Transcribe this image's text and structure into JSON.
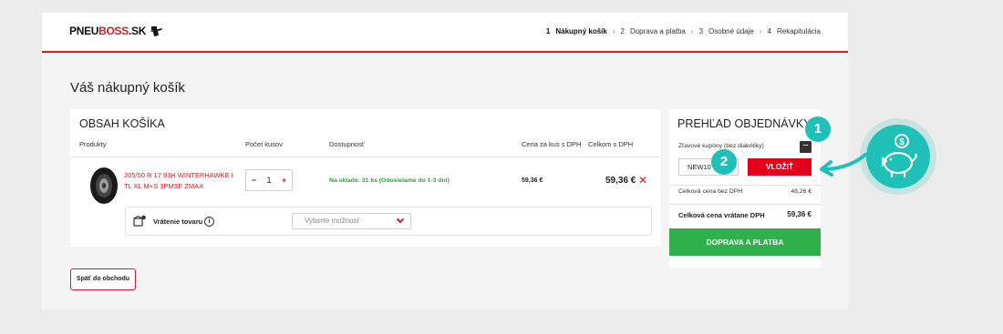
{
  "header": {
    "logo": {
      "pneu": "PNEU",
      "boss": "BOSS",
      "sk": ".SK"
    },
    "steps": [
      {
        "num": "1",
        "label": "Nákupný košík"
      },
      {
        "num": "2",
        "label": "Doprava a platba"
      },
      {
        "num": "3",
        "label": "Osobné údaje"
      },
      {
        "num": "4",
        "label": "Rekapitulácia"
      }
    ]
  },
  "page_title": "Váš nákupný košík",
  "cart": {
    "title": "OBSAH KOŠÍKA",
    "columns": {
      "product": "Produkty",
      "quantity": "Počet kusov",
      "availability": "Dostupnosť",
      "unit_price": "Cena za kus s DPH",
      "total": "Celkom s DPH"
    },
    "item": {
      "name": "205/50 R 17 93H WINTERHAWKE I TL XL M+S 3PMSF ZMAX",
      "quantity": "1",
      "availability": "Na sklade: 31 ks (Odosielame do 1-3 dní)",
      "unit_price": "59,36 €",
      "total": "59,36 €"
    },
    "returns": {
      "label": "Vrátenie tovaru",
      "select_placeholder": "Vyberte možnosť"
    }
  },
  "back_button": "Späť do obchodu",
  "summary": {
    "title": "PREHĽAD OBJEDNÁVKY",
    "coupon_label": "Zľavové kupóny (bez diakritiky)",
    "coupon_value": "NEW10",
    "coupon_button": "VLOŽIŤ",
    "subtotal_label": "Celková cena bez DPH",
    "subtotal_value": "48,26 €",
    "total_label": "Celková cena vrátane DPH",
    "total_value": "59,36 €",
    "checkout_button": "DOPRAVA A PLATBA"
  },
  "annotations": {
    "badge1": "1",
    "badge2": "2"
  },
  "colors": {
    "brand_red": "#d0202a",
    "cta_green": "#2eb14b",
    "accent_teal": "#1ec0b8"
  }
}
